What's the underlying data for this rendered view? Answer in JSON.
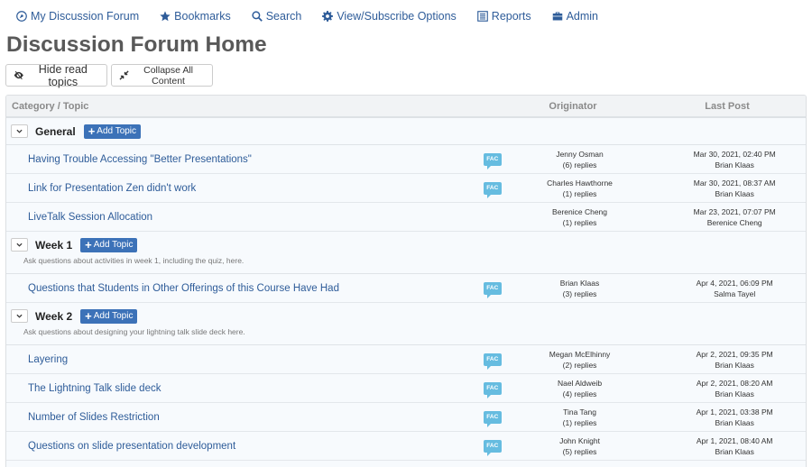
{
  "nav": [
    {
      "label": "My Discussion Forum",
      "icon": "forum-icon"
    },
    {
      "label": "Bookmarks",
      "icon": "star-icon"
    },
    {
      "label": "Search",
      "icon": "search-icon"
    },
    {
      "label": "View/Subscribe Options",
      "icon": "gear-icon"
    },
    {
      "label": "Reports",
      "icon": "list-icon"
    },
    {
      "label": "Admin",
      "icon": "briefcase-icon"
    }
  ],
  "page_title": "Discussion Forum Home",
  "toolbar": {
    "hide_read": "Hide read topics",
    "collapse_all": "Collapse All Content"
  },
  "table": {
    "headers": {
      "topic": "Category / Topic",
      "originator": "Originator",
      "last_post": "Last Post"
    },
    "fac_label": "FAC",
    "add_topic": "Add Topic",
    "categories": [
      {
        "name": "General",
        "description": "",
        "topics": [
          {
            "title": "Having Trouble Accessing \"Better Presentations\"",
            "fac": true,
            "originator": "Jenny Osman",
            "replies": "(6) replies",
            "last_date": "Mar 30, 2021, 02:40 PM",
            "last_by": "Brian Klaas"
          },
          {
            "title": "Link for Presentation Zen didn't work",
            "fac": true,
            "originator": "Charles Hawthorne",
            "replies": "(1) replies",
            "last_date": "Mar 30, 2021, 08:37 AM",
            "last_by": "Brian Klaas"
          },
          {
            "title": "LiveTalk Session Allocation",
            "fac": false,
            "originator": "Berenice Cheng",
            "replies": "(1) replies",
            "last_date": "Mar 23, 2021, 07:07 PM",
            "last_by": "Berenice Cheng"
          }
        ]
      },
      {
        "name": "Week 1",
        "description": "Ask questions about activities in week 1, including the quiz, here.",
        "topics": [
          {
            "title": "Questions that Students in Other Offerings of this Course Have Had",
            "fac": true,
            "originator": "Brian Klaas",
            "replies": "(3) replies",
            "last_date": "Apr 4, 2021, 06:09 PM",
            "last_by": "Salma Tayel"
          }
        ]
      },
      {
        "name": "Week 2",
        "description": "Ask questions about designing your lightning talk slide deck here.",
        "topics": [
          {
            "title": "Layering",
            "fac": true,
            "originator": "Megan McElhinny",
            "replies": "(2) replies",
            "last_date": "Apr 2, 2021, 09:35 PM",
            "last_by": "Brian Klaas"
          },
          {
            "title": "The Lightning Talk slide deck",
            "fac": true,
            "originator": "Nael Aldweib",
            "replies": "(4) replies",
            "last_date": "Apr 2, 2021, 08:20 AM",
            "last_by": "Brian Klaas"
          },
          {
            "title": "Number of Slides Restriction",
            "fac": true,
            "originator": "Tina Tang",
            "replies": "(1) replies",
            "last_date": "Apr 1, 2021, 03:38 PM",
            "last_by": "Brian Klaas"
          },
          {
            "title": "Questions on slide presentation development",
            "fac": true,
            "originator": "John Knight",
            "replies": "(5) replies",
            "last_date": "Apr 1, 2021, 08:40 AM",
            "last_by": "Brian Klaas"
          }
        ]
      }
    ]
  },
  "colors": {
    "link": "#2e5c99",
    "accent": "#3c72b8",
    "fac": "#66bce0",
    "title": "#595959"
  }
}
